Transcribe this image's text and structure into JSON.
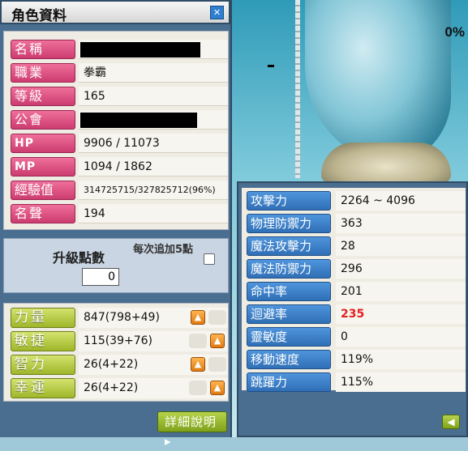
{
  "window": {
    "title": "角色資料",
    "close_glyph": "✕"
  },
  "scene": {
    "percent_text": "0%"
  },
  "profile": [
    {
      "label": "名稱",
      "value": "",
      "redacted": true
    },
    {
      "label": "職業",
      "value": "拳霸"
    },
    {
      "label": "等級",
      "value": "165"
    },
    {
      "label": "公會",
      "value": "",
      "redacted": true
    },
    {
      "label": "HP",
      "value": "9906 / 11073"
    },
    {
      "label": "MP",
      "value": "1094 / 1862"
    },
    {
      "label": "經驗值",
      "value": "314725715/327825712(96%)"
    },
    {
      "label": "名聲",
      "value": "194"
    }
  ],
  "level_up": {
    "label": "升級點數",
    "points": "0",
    "each_label": "每次追加5點",
    "each_checked": false
  },
  "stats": [
    {
      "label": "力量",
      "value": "847(798+49)"
    },
    {
      "label": "敏捷",
      "value": "115(39+76)"
    },
    {
      "label": "智力",
      "value": "26(4+22)"
    },
    {
      "label": "幸運",
      "value": "26(4+22)"
    }
  ],
  "detail_button": "詳細說明",
  "details": [
    {
      "label": "攻擊力",
      "value": "2264 ~ 4096"
    },
    {
      "label": "物理防禦力",
      "value": "363"
    },
    {
      "label": "魔法攻擊力",
      "value": "28"
    },
    {
      "label": "魔法防禦力",
      "value": "296"
    },
    {
      "label": "命中率",
      "value": "201"
    },
    {
      "label": "迴避率",
      "value": "235",
      "highlight": true
    },
    {
      "label": "靈敏度",
      "value": "0"
    },
    {
      "label": "移動速度",
      "value": "119%"
    },
    {
      "label": "跳躍力",
      "value": "115%"
    }
  ],
  "icons": {
    "up": "arrow-up-icon",
    "back": "arrow-left-icon",
    "close": "close-icon"
  },
  "colors": {
    "profile_label": "#cc3c6f",
    "stat_label": "#9fb62a",
    "detail_label": "#2f6fb6",
    "highlight_value": "#e22020"
  }
}
